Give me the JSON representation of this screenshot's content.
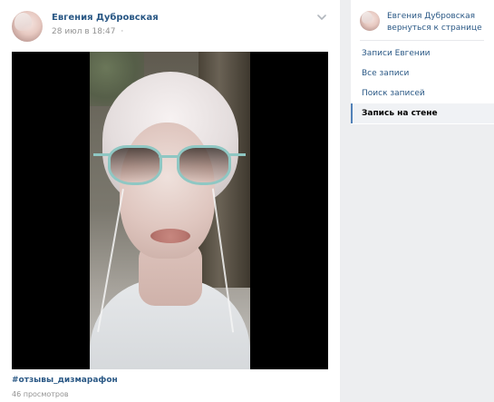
{
  "post": {
    "author_name": "Евгения Дубровская",
    "date": "28 июл в 18:47",
    "date_separator": "·",
    "hashtag": "#отзывы_дизмарафон",
    "views": "46 просмотров"
  },
  "sidebar": {
    "profile_name": "Евгения Дубровская",
    "return_link": "вернуться к странице",
    "items": [
      {
        "label": "Записи Евгении"
      },
      {
        "label": "Все записи"
      },
      {
        "label": "Поиск записей"
      },
      {
        "label": "Запись на стене",
        "active": true
      }
    ]
  },
  "colors": {
    "link": "#2a5885",
    "meta": "#939393",
    "background": "#edeef0",
    "active_indicator": "#5181b8"
  },
  "icons": {
    "post_menu": "chevron-down-icon"
  }
}
